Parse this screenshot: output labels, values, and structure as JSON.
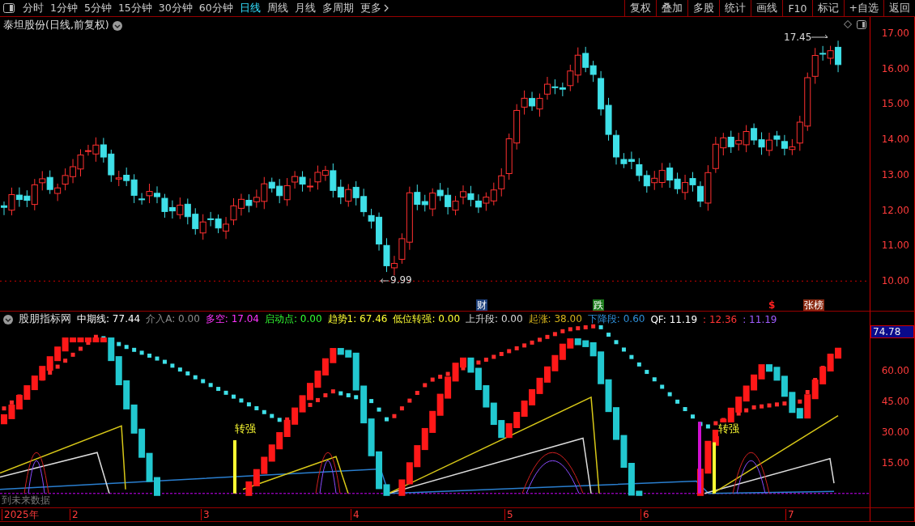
{
  "toolbar": {
    "periods": [
      {
        "label": "分时",
        "selected": false
      },
      {
        "label": "1分钟",
        "selected": false
      },
      {
        "label": "5分钟",
        "selected": false
      },
      {
        "label": "15分钟",
        "selected": false
      },
      {
        "label": "30分钟",
        "selected": false
      },
      {
        "label": "60分钟",
        "selected": false
      },
      {
        "label": "日线",
        "selected": true
      },
      {
        "label": "周线",
        "selected": false
      },
      {
        "label": "月线",
        "selected": false
      },
      {
        "label": "多周期",
        "selected": false
      }
    ],
    "more": "更多",
    "buttons": [
      "复权",
      "叠加",
      "多股",
      "统计",
      "画线",
      "F10",
      "标记",
      "+自选",
      "返回"
    ]
  },
  "price_panel": {
    "title": "泰坦股份(日线,前复权)",
    "high_label": "17.45",
    "low_label": "9.99",
    "y_axis": [
      "17.00",
      "16.00",
      "15.00",
      "14.00",
      "13.00",
      "12.00",
      "11.00",
      "10.00"
    ],
    "markers": [
      {
        "text": "财",
        "kind": "badge",
        "color": "#1c3f7a"
      },
      {
        "text": "跌",
        "kind": "badge",
        "color": "#1d7a1d"
      },
      {
        "text": "$",
        "kind": "plain",
        "color": "#ff2020"
      },
      {
        "text": "张榜",
        "kind": "badge",
        "color": "#8a2a12"
      }
    ]
  },
  "indicator_panel": {
    "name": "股朋指标网",
    "values": [
      {
        "text": "中期线: 77.44",
        "color": "#ffffff"
      },
      {
        "text": "介入A: 0.00",
        "color": "#8c8c8c"
      },
      {
        "text": "多空: 17.04",
        "color": "#ff33ff"
      },
      {
        "text": "启动点: 0.00",
        "color": "#33ff33"
      },
      {
        "text": "趋势1: 67.46",
        "color": "#ffff33"
      },
      {
        "text": "低位转强: 0.00",
        "color": "#ffff33"
      },
      {
        "text": "上升段: 0.00",
        "color": "#d8d8d8"
      },
      {
        "text": "起涨: 38.00",
        "color": "#d4b21c"
      },
      {
        "text": "下降段: 0.60",
        "color": "#2f8fd8"
      },
      {
        "text": "QF: 11.19",
        "color": "#ffffff"
      },
      {
        "text": ": 12.36",
        "color": "#ff3333"
      },
      {
        "text": ": 11.19",
        "color": "#a05cff"
      }
    ],
    "current_value": "74.78",
    "y_axis": [
      "60.00",
      "45.00",
      "30.00",
      "15.00"
    ],
    "signals": [
      "转强",
      "转强"
    ],
    "overlay_text": "到未来数据"
  },
  "date_axis": [
    "2025年",
    "2",
    "3",
    "4",
    "5",
    "6",
    "7"
  ]
}
